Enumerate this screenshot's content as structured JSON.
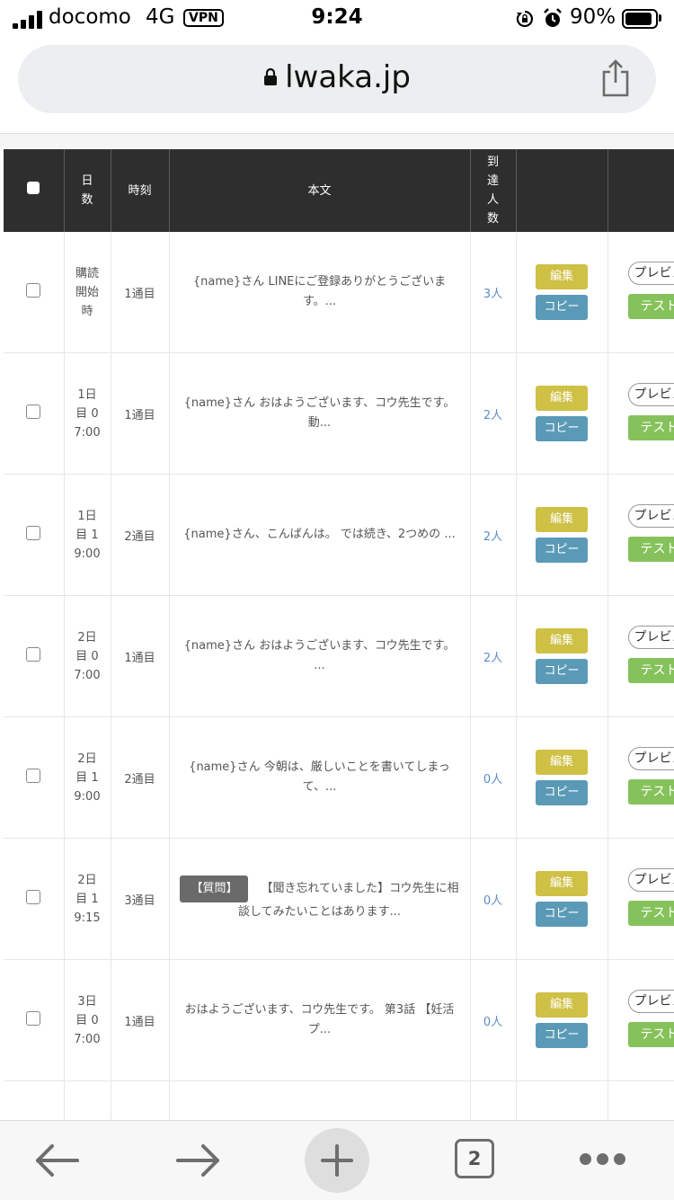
{
  "status_bar": {
    "carrier": "docomo",
    "network": "4G",
    "vpn": "VPN",
    "time": "9:24",
    "battery": "90%"
  },
  "address_bar": {
    "url": "lwaka.jp"
  },
  "table": {
    "headers": {
      "select_all": "",
      "days": "日数",
      "time": "時刻",
      "body": "本文",
      "reach": "到達人数"
    },
    "rows": [
      {
        "day": "購読開始時",
        "time": "1通目",
        "tag": "",
        "body": "{name}さん LINEにご登録ありがとうございます。...",
        "reach": "3人",
        "edit": "編集",
        "copy": "コピー",
        "preview": "プレビュー",
        "test": "テスト"
      },
      {
        "day": "1日目 0 7:00",
        "time": "1通目",
        "tag": "",
        "body": "{name}さん おはようございます、コウ先生です。 動...",
        "reach": "2人",
        "edit": "編集",
        "copy": "コピー",
        "preview": "プレビュー",
        "test": "テスト"
      },
      {
        "day": "1日目 1 9:00",
        "time": "2通目",
        "tag": "",
        "body": "{name}さん、こんばんは。 では続き、2つめの ...",
        "reach": "2人",
        "edit": "編集",
        "copy": "コピー",
        "preview": "プレビュー",
        "test": "テスト"
      },
      {
        "day": "2日目 0 7:00",
        "time": "1通目",
        "tag": "",
        "body": "{name}さん おはようございます、コウ先生です。 ...",
        "reach": "2人",
        "edit": "編集",
        "copy": "コピー",
        "preview": "プレビュー",
        "test": "テスト"
      },
      {
        "day": "2日目 1 9:00",
        "time": "2通目",
        "tag": "",
        "body": "{name}さん 今朝は、厳しいことを書いてしまって、...",
        "reach": "0人",
        "edit": "編集",
        "copy": "コピー",
        "preview": "プレビュー",
        "test": "テスト"
      },
      {
        "day": "2日目 1 9:15",
        "time": "3通目",
        "tag": "【質問】",
        "body": "【聞き忘れていました】コウ先生に相談してみたいことはあります...",
        "reach": "0人",
        "edit": "編集",
        "copy": "コピー",
        "preview": "プレビュー",
        "test": "テスト"
      },
      {
        "day": "3日目 0 7:00",
        "time": "1通目",
        "tag": "",
        "body": "おはようございます、コウ先生です。 第3話 【妊活プ...",
        "reach": "0人",
        "edit": "編集",
        "copy": "コピー",
        "preview": "プレビュー",
        "test": "テスト"
      }
    ]
  },
  "bottom_bar": {
    "tab_count": "2"
  }
}
